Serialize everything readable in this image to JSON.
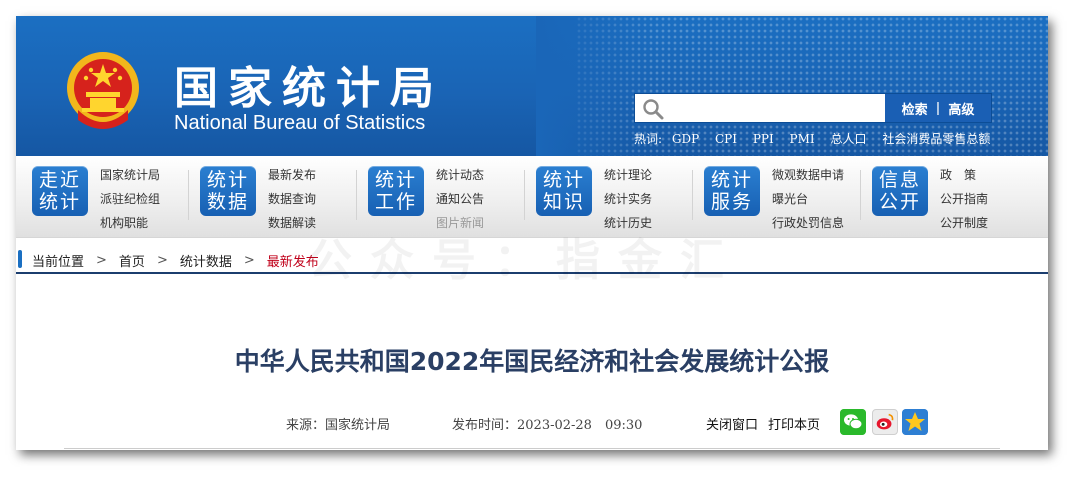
{
  "header": {
    "title_cn": "国家统计局",
    "title_en": "National Bureau of Statistics",
    "search": {
      "placeholder": "",
      "search_label": "检索",
      "separator": "|",
      "advanced_label": "高级"
    },
    "hot_words_label": "热词:",
    "hot_words": [
      "GDP",
      "CPI",
      "PPI",
      "PMI",
      "总人口",
      "社会消费品零售总额"
    ]
  },
  "nav": {
    "groups": [
      {
        "badge": [
          "走近",
          "统计"
        ],
        "links": [
          "国家统计局",
          "派驻纪检组",
          "机构职能"
        ]
      },
      {
        "badge": [
          "统计",
          "数据"
        ],
        "links": [
          "最新发布",
          "数据查询",
          "数据解读"
        ]
      },
      {
        "badge": [
          "统计",
          "工作"
        ],
        "links": [
          "统计动态",
          "通知公告",
          "图片新闻"
        ]
      },
      {
        "badge": [
          "统计",
          "知识"
        ],
        "links": [
          "统计理论",
          "统计实务",
          "统计历史"
        ]
      },
      {
        "badge": [
          "统计",
          "服务"
        ],
        "links": [
          "微观数据申请",
          "曝光台",
          "行政处罚信息"
        ]
      },
      {
        "badge": [
          "信息",
          "公开"
        ],
        "links": [
          "政　策",
          "公开指南",
          "公开制度"
        ]
      }
    ]
  },
  "breadcrumb": {
    "items": [
      "当前位置",
      "首页",
      "统计数据",
      "最新发布"
    ],
    "separator": ">"
  },
  "watermark": "公众号：指金汇",
  "article": {
    "title": "中华人民共和国2022年国民经济和社会发展统计公报",
    "source": "来源：国家统计局",
    "published": "发布时间：2023-02-28　09:30",
    "close_window": "关闭窗口",
    "print_page": "打印本页"
  },
  "colors": {
    "header_blue": "#1a64b5",
    "breadcrumb_current": "#c0001a",
    "title_color": "#2a3f64"
  }
}
